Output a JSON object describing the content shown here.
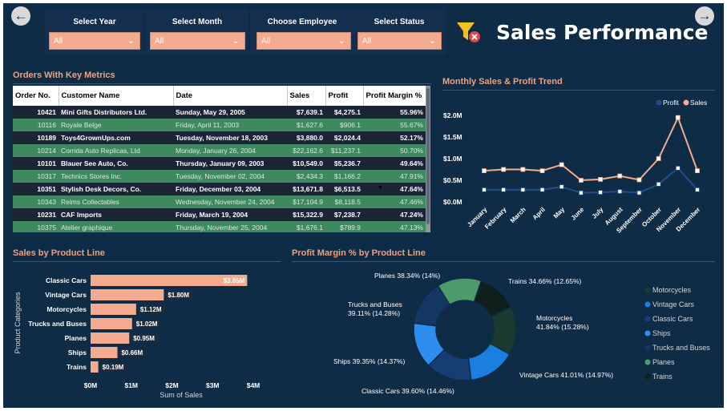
{
  "dashboard": {
    "title": "Sales Performance",
    "nav": {
      "back_icon": "arrow-left-icon",
      "forward_icon": "arrow-right-icon"
    },
    "filter_icon": "filter-clear-icon",
    "colors": {
      "background": "#0f2c47",
      "accent": "#f4ab8f",
      "title_accent": "#f0a07f"
    }
  },
  "filters": [
    {
      "label": "Select Year",
      "value": "All"
    },
    {
      "label": "Select Month",
      "value": "All"
    },
    {
      "label": "Choose Employee",
      "value": "All"
    },
    {
      "label": "Select Status",
      "value": "All"
    }
  ],
  "orders_table": {
    "title": "Orders With Key Metrics",
    "columns": [
      "Order No.",
      "Customer Name",
      "Date",
      "Sales",
      "Profit",
      "Profit Margin %"
    ],
    "rows": [
      [
        "10421",
        "Mini Gifts Distributors Ltd.",
        "Sunday, May 29, 2005",
        "$7,639.1",
        "$4,275.1",
        "55.96%"
      ],
      [
        "10116",
        "Royale Belge",
        "Friday, April 11, 2003",
        "$1,627.6",
        "$906.1",
        "55.67%"
      ],
      [
        "10189",
        "Toys4GrownUps.com",
        "Tuesday, November 18, 2003",
        "$3,880.0",
        "$2,024.4",
        "52.17%"
      ],
      [
        "10214",
        "Corrida Auto Replicas, Ltd",
        "Monday, January 26, 2004",
        "$22,162.6",
        "$11,237.1",
        "50.70%"
      ],
      [
        "10101",
        "Blauer See Auto, Co.",
        "Thursday, January 09, 2003",
        "$10,549.0",
        "$5,236.7",
        "49.64%"
      ],
      [
        "10317",
        "Technics Stores Inc.",
        "Tuesday, November 02, 2004",
        "$2,434.3",
        "$1,166.2",
        "47.91%"
      ],
      [
        "10351",
        "Stylish Desk Decors, Co.",
        "Friday, December 03, 2004",
        "$13,671.8",
        "$6,513.5",
        "47.64%"
      ],
      [
        "10343",
        "Reims Collectables",
        "Wednesday, November 24, 2004",
        "$17,104.9",
        "$8,118.5",
        "47.46%"
      ],
      [
        "10231",
        "CAF Imports",
        "Friday, March 19, 2004",
        "$15,322.9",
        "$7,238.7",
        "47.24%"
      ],
      [
        "10375",
        "Atelier graphique",
        "Thursday, November 25, 2004",
        "$1,676.1",
        "$789.9",
        "47.13%"
      ]
    ]
  },
  "chart_data": [
    {
      "type": "line",
      "title": "Monthly Sales & Profit Trend",
      "x": [
        "January",
        "February",
        "March",
        "April",
        "May",
        "June",
        "July",
        "August",
        "September",
        "October",
        "November",
        "December"
      ],
      "series": [
        {
          "name": "Profit",
          "color": "#1f4e8c",
          "values": [
            0.28,
            0.28,
            0.28,
            0.28,
            0.35,
            0.21,
            0.22,
            0.24,
            0.21,
            0.41,
            0.78,
            0.28
          ]
        },
        {
          "name": "Sales",
          "color": "#f4ab8f",
          "values": [
            0.72,
            0.75,
            0.75,
            0.72,
            0.86,
            0.5,
            0.52,
            0.6,
            0.51,
            1.0,
            1.95,
            0.72
          ]
        }
      ],
      "yticks": [
        "$0.0M",
        "$0.5M",
        "$1.0M",
        "$1.5M",
        "$2.0M"
      ],
      "ylim": [
        0,
        2.0
      ],
      "legend": "top-right"
    },
    {
      "type": "bar",
      "orientation": "horizontal",
      "title": "Sales by Product Line",
      "categories": [
        "Classic Cars",
        "Vintage Cars",
        "Motorcycles",
        "Trucks and Buses",
        "Planes",
        "Ships",
        "Trains"
      ],
      "values": [
        3.85,
        1.8,
        1.12,
        1.02,
        0.95,
        0.66,
        0.19
      ],
      "labels": [
        "$3.85M",
        "$1.80M",
        "$1.12M",
        "$1.02M",
        "$0.95M",
        "$0.66M",
        "$0.19M"
      ],
      "xticks": [
        "$0M",
        "$1M",
        "$2M",
        "$3M",
        "$4M"
      ],
      "xlim": [
        0,
        4
      ],
      "xlabel": "Sum of Sales",
      "ylabel": "Product Categories",
      "color": "#f4ab8f"
    },
    {
      "type": "pie",
      "donut": true,
      "title": "Profit Margin % by Product Line",
      "slices": [
        {
          "name": "Motorcycles",
          "value": 41.84,
          "share": 15.28,
          "label": "Motorcycles\n41.84% (15.28%)",
          "color": "#1b3a2e"
        },
        {
          "name": "Vintage Cars",
          "value": 41.01,
          "share": 14.97,
          "label": "Vintage Cars 41.01% (14.97%)",
          "color": "#1a7fe0"
        },
        {
          "name": "Classic Cars",
          "value": 39.6,
          "share": 14.46,
          "label": "Classic Cars 39.60% (14.46%)",
          "color": "#163e73"
        },
        {
          "name": "Ships",
          "value": 39.35,
          "share": 14.37,
          "label": "Ships 39.35% (14.37%)",
          "color": "#2e8df0"
        },
        {
          "name": "Trucks and Buses",
          "value": 39.11,
          "share": 14.28,
          "label": "Trucks and Buses\n39.11% (14.28%)",
          "color": "#143663"
        },
        {
          "name": "Planes",
          "value": 38.34,
          "share": 14.0,
          "label": "Planes 38.34% (14%)",
          "color": "#4e9a6a"
        },
        {
          "name": "Trains",
          "value": 34.66,
          "share": 12.65,
          "label": "Trains 34.66% (12.65%)",
          "color": "#101f1c"
        }
      ],
      "legend": [
        "Motorcycles",
        "Vintage Cars",
        "Classic Cars",
        "Ships",
        "Trucks and Buses",
        "Planes",
        "Trains"
      ],
      "legend_position": "right"
    }
  ]
}
